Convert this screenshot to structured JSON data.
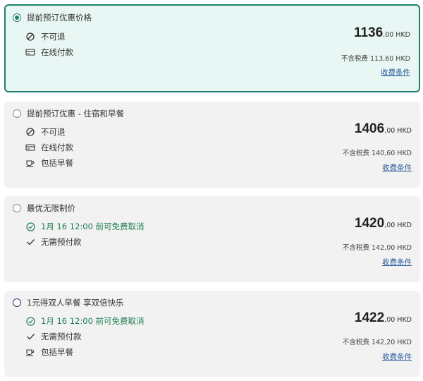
{
  "options": [
    {
      "title": "提前预订优惠价格",
      "features": [
        {
          "icon": "no-entry-icon",
          "text": "不可退"
        },
        {
          "icon": "credit-card-icon",
          "text": "在线付款"
        }
      ],
      "price_main": "1136",
      "price_cents": ",00 HKD",
      "tax": "不含税费 113,60 HKD",
      "terms": "收费条件",
      "selected": true
    },
    {
      "title": "提前预订优惠 - 住宿和早餐",
      "features": [
        {
          "icon": "no-entry-icon",
          "text": "不可退"
        },
        {
          "icon": "credit-card-icon",
          "text": "在线付款"
        },
        {
          "icon": "coffee-cup-icon",
          "text": "包括早餐"
        }
      ],
      "price_main": "1406",
      "price_cents": ",00 HKD",
      "tax": "不含税费 140,60 HKD",
      "terms": "收费条件",
      "selected": false
    },
    {
      "title": "最优无限制价",
      "features": [
        {
          "icon": "check-circle-icon",
          "text": "1月 16 12:00 前可免费取消"
        },
        {
          "icon": "check-icon",
          "text": "无需预付款"
        }
      ],
      "price_main": "1420",
      "price_cents": ",00 HKD",
      "tax": "不含税费 142,00 HKD",
      "terms": "收费条件",
      "selected": false
    },
    {
      "title": "1元得双人早餐 享双倍快乐",
      "features": [
        {
          "icon": "check-circle-icon",
          "text": "1月 16 12:00 前可免费取消"
        },
        {
          "icon": "check-icon",
          "text": "无需预付款"
        },
        {
          "icon": "coffee-cup-icon",
          "text": "包括早餐"
        }
      ],
      "price_main": "1422",
      "price_cents": ",00 HKD",
      "tax": "不含税费 142,20 HKD",
      "terms": "收费条件",
      "selected": false
    }
  ],
  "colors": {
    "accent": "#1f7f6d",
    "selected_bg": "#e9f7f4",
    "card_bg": "#f2f2f3",
    "free_cancel_text": "#1d7d4e",
    "link": "#2b5b9a"
  }
}
